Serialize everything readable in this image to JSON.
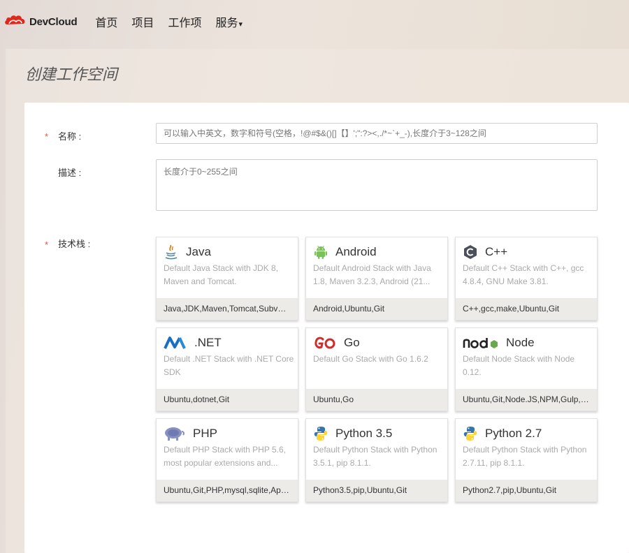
{
  "header": {
    "logo_text": "DevCloud",
    "nav": [
      {
        "label": "首页"
      },
      {
        "label": "项目"
      },
      {
        "label": "工作项"
      },
      {
        "label": "服务",
        "caret": "▾"
      }
    ]
  },
  "page_title": "创建工作空间",
  "form": {
    "required_mark": "*",
    "name_label": "名称 :",
    "name_placeholder": "可以输入中英文，数字和符号(空格，!@#$&()[]【】';\":?><,./*~`+_-),长度介于3~128之间",
    "desc_label": "描述 :",
    "desc_placeholder": "长度介于0~255之间",
    "stack_label": "技术栈 :"
  },
  "stacks": [
    {
      "name": "Java",
      "icon": "java-icon",
      "desc": "Default Java Stack with JDK 8, Maven and Tomcat.",
      "tags": "Java,JDK,Maven,Tomcat,Subversion,Ubuntu,Git"
    },
    {
      "name": "Android",
      "icon": "android-icon",
      "desc": "Default Android Stack with Java 1.8, Maven 3.2.3, Android (21...",
      "tags": "Android,Ubuntu,Git"
    },
    {
      "name": "C++",
      "icon": "cpp-icon",
      "desc": "Default C++ Stack with C++, gcc 4.8.4, GNU Make 3.81.",
      "tags": "C++,gcc,make,Ubuntu,Git"
    },
    {
      "name": ".NET",
      "icon": "dotnet-icon",
      "desc": "Default .NET Stack with .NET Core SDK",
      "tags": "Ubuntu,dotnet,Git"
    },
    {
      "name": "Go",
      "icon": "go-icon",
      "desc": "Default Go Stack with Go 1.6.2",
      "tags": "Ubuntu,Go"
    },
    {
      "name": "Node",
      "icon": "node-icon",
      "desc": "Default Node Stack with Node 0.12.",
      "tags": "Ubuntu,Git,Node.JS,NPM,Gulp,Bower"
    },
    {
      "name": "PHP",
      "icon": "php-icon",
      "desc": "Default PHP Stack with PHP 5.6, most popular extensions and...",
      "tags": "Ubuntu,Git,PHP,mysql,sqlite,Apache"
    },
    {
      "name": "Python 3.5",
      "icon": "python-icon",
      "desc": "Default Python Stack with Python 3.5.1, pip 8.1.1.",
      "tags": "Python3.5,pip,Ubuntu,Git"
    },
    {
      "name": "Python 2.7",
      "icon": "python-icon",
      "desc": "Default Python Stack with Python 2.7.11, pip 8.1.1.",
      "tags": "Python2.7,pip,Ubuntu,Git"
    }
  ],
  "colors": {
    "required": "#e05a3a",
    "logo_red": "#e1261c"
  }
}
